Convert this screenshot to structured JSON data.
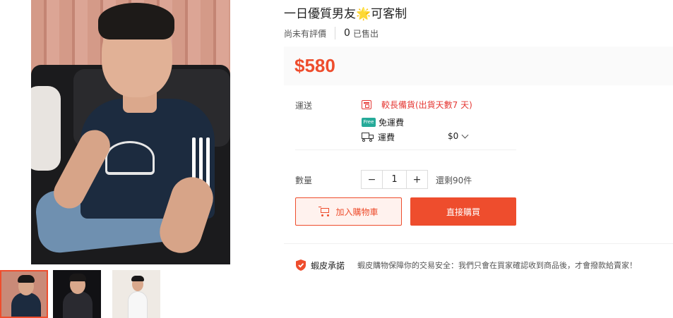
{
  "product": {
    "title": "一日優質男友",
    "title_emoji": "🌟",
    "title_suffix": "可客制",
    "no_rating_label": "尚未有評價",
    "sold_count": "0",
    "sold_label": "已售出",
    "price": "$580"
  },
  "shipping": {
    "label": "運送",
    "preorder_text": "較長備貨(出貨天數7 天)",
    "free_badge": "Free",
    "free_shipping_label": "免運費",
    "fee_label": "運費",
    "fee_value": "$0"
  },
  "quantity": {
    "label": "數量",
    "minus": "−",
    "value": "1",
    "plus": "+",
    "stock": "還剩90件"
  },
  "actions": {
    "add_to_cart": "加入購物車",
    "buy_now": "直接購買"
  },
  "guarantee": {
    "title": "蝦皮承諾",
    "text": "蝦皮購物保障你的交易安全：我們只會在買家確認收到商品後，才會撥款給賣家！"
  },
  "icons": {
    "preorder": "calendar-icon",
    "free_shipping": "free-shipping-icon",
    "shipping_fee": "truck-icon",
    "fee_dropdown": "chevron-down-icon",
    "cart": "add-to-cart-icon",
    "guarantee": "shield-icon"
  },
  "colors": {
    "accent": "#ee4d2d",
    "preorder": "#e53935",
    "free_shipping": "#26aa99",
    "price_background": "#fafafa"
  }
}
